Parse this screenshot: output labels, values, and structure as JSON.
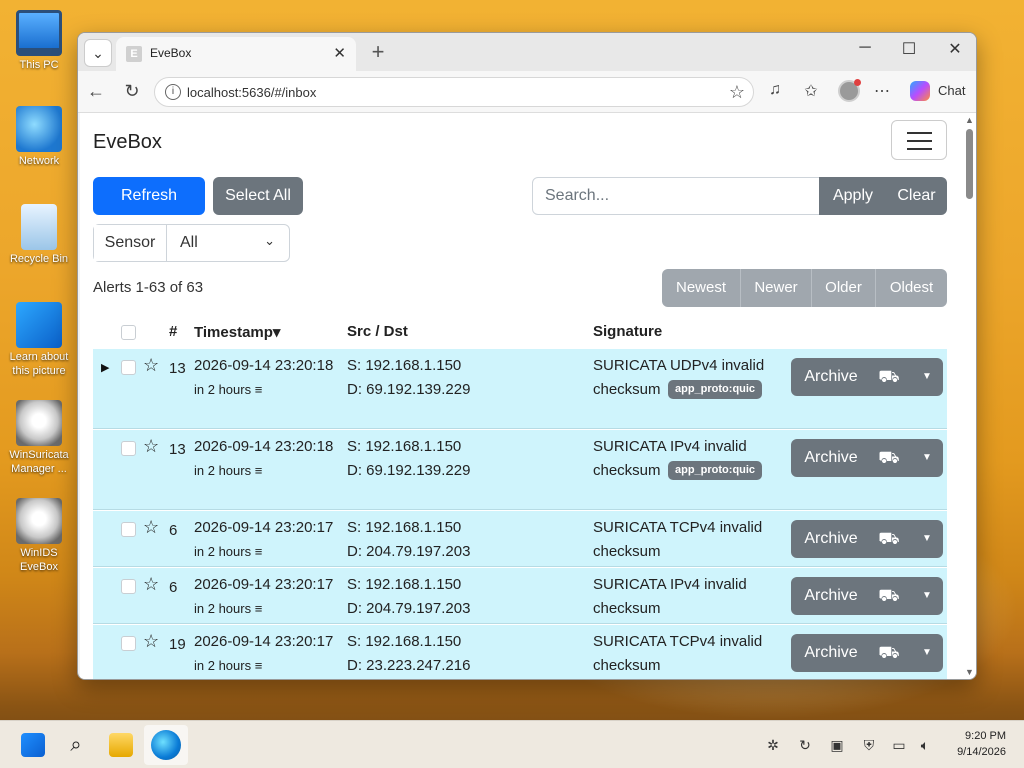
{
  "desktop": {
    "icons": [
      {
        "label": "This PC",
        "icon": "computer-icon"
      },
      {
        "label": "Network",
        "icon": "network-icon"
      },
      {
        "label": "Recycle Bin",
        "icon": "recycle-bin-icon"
      },
      {
        "label": "Learn about this picture",
        "icon": "learn-picture-icon"
      },
      {
        "label": "WinSuricata Manager ...",
        "icon": "winsuricata-icon"
      },
      {
        "label": "WinIDS EveBox",
        "icon": "winids-evebox-icon"
      }
    ]
  },
  "browser": {
    "tab_title": "EveBox",
    "url": "localhost:5636/#/inbox",
    "chat_label": "Chat"
  },
  "app": {
    "brand": "EveBox",
    "toolbar": {
      "refresh_label": "Refresh",
      "select_all_label": "Select All",
      "search_placeholder": "Search...",
      "apply_label": "Apply",
      "clear_label": "Clear"
    },
    "sensor": {
      "label": "Sensor",
      "value": "All"
    },
    "alert_count": "Alerts 1-63 of 63",
    "pager": {
      "newest": "Newest",
      "newer": "Newer",
      "older": "Older",
      "oldest": "Oldest"
    },
    "columns": {
      "num": "#",
      "timestamp": "Timestamp",
      "src_dst": "Src / Dst",
      "signature": "Signature"
    },
    "rows": [
      {
        "count": "13",
        "timestamp": "2026-09-14 23:20:18",
        "ago": "in 2 hours",
        "src": "S: 192.168.1.150",
        "dst": "D: 69.192.139.229",
        "sig_line1": "SURICATA UDPv4 invalid",
        "sig_line2": "checksum",
        "badge": "app_proto:quic",
        "archive": "Archive"
      },
      {
        "count": "13",
        "timestamp": "2026-09-14 23:20:18",
        "ago": "in 2 hours",
        "src": "S: 192.168.1.150",
        "dst": "D: 69.192.139.229",
        "sig_line1": "SURICATA IPv4 invalid",
        "sig_line2": "checksum",
        "badge": "app_proto:quic",
        "archive": "Archive"
      },
      {
        "count": "6",
        "timestamp": "2026-09-14 23:20:17",
        "ago": "in 2 hours",
        "src": "S: 192.168.1.150",
        "dst": "D: 204.79.197.203",
        "sig_line1": "SURICATA TCPv4 invalid",
        "sig_line2": "checksum",
        "badge": "",
        "archive": "Archive"
      },
      {
        "count": "6",
        "timestamp": "2026-09-14 23:20:17",
        "ago": "in 2 hours",
        "src": "S: 192.168.1.150",
        "dst": "D: 204.79.197.203",
        "sig_line1": "SURICATA IPv4 invalid",
        "sig_line2": "checksum",
        "badge": "",
        "archive": "Archive"
      },
      {
        "count": "19",
        "timestamp": "2026-09-14 23:20:17",
        "ago": "in 2 hours",
        "src": "S: 192.168.1.150",
        "dst": "D: 23.223.247.216",
        "sig_line1": "SURICATA TCPv4 invalid",
        "sig_line2": "checksum",
        "badge": "",
        "archive": "Archive"
      }
    ],
    "colors": {
      "primary": "#0d6efd",
      "secondary": "#6c757d",
      "row_bg": "#cff4fc"
    }
  },
  "taskbar": {
    "time": "9:20 PM",
    "date": "9/14/2026"
  }
}
